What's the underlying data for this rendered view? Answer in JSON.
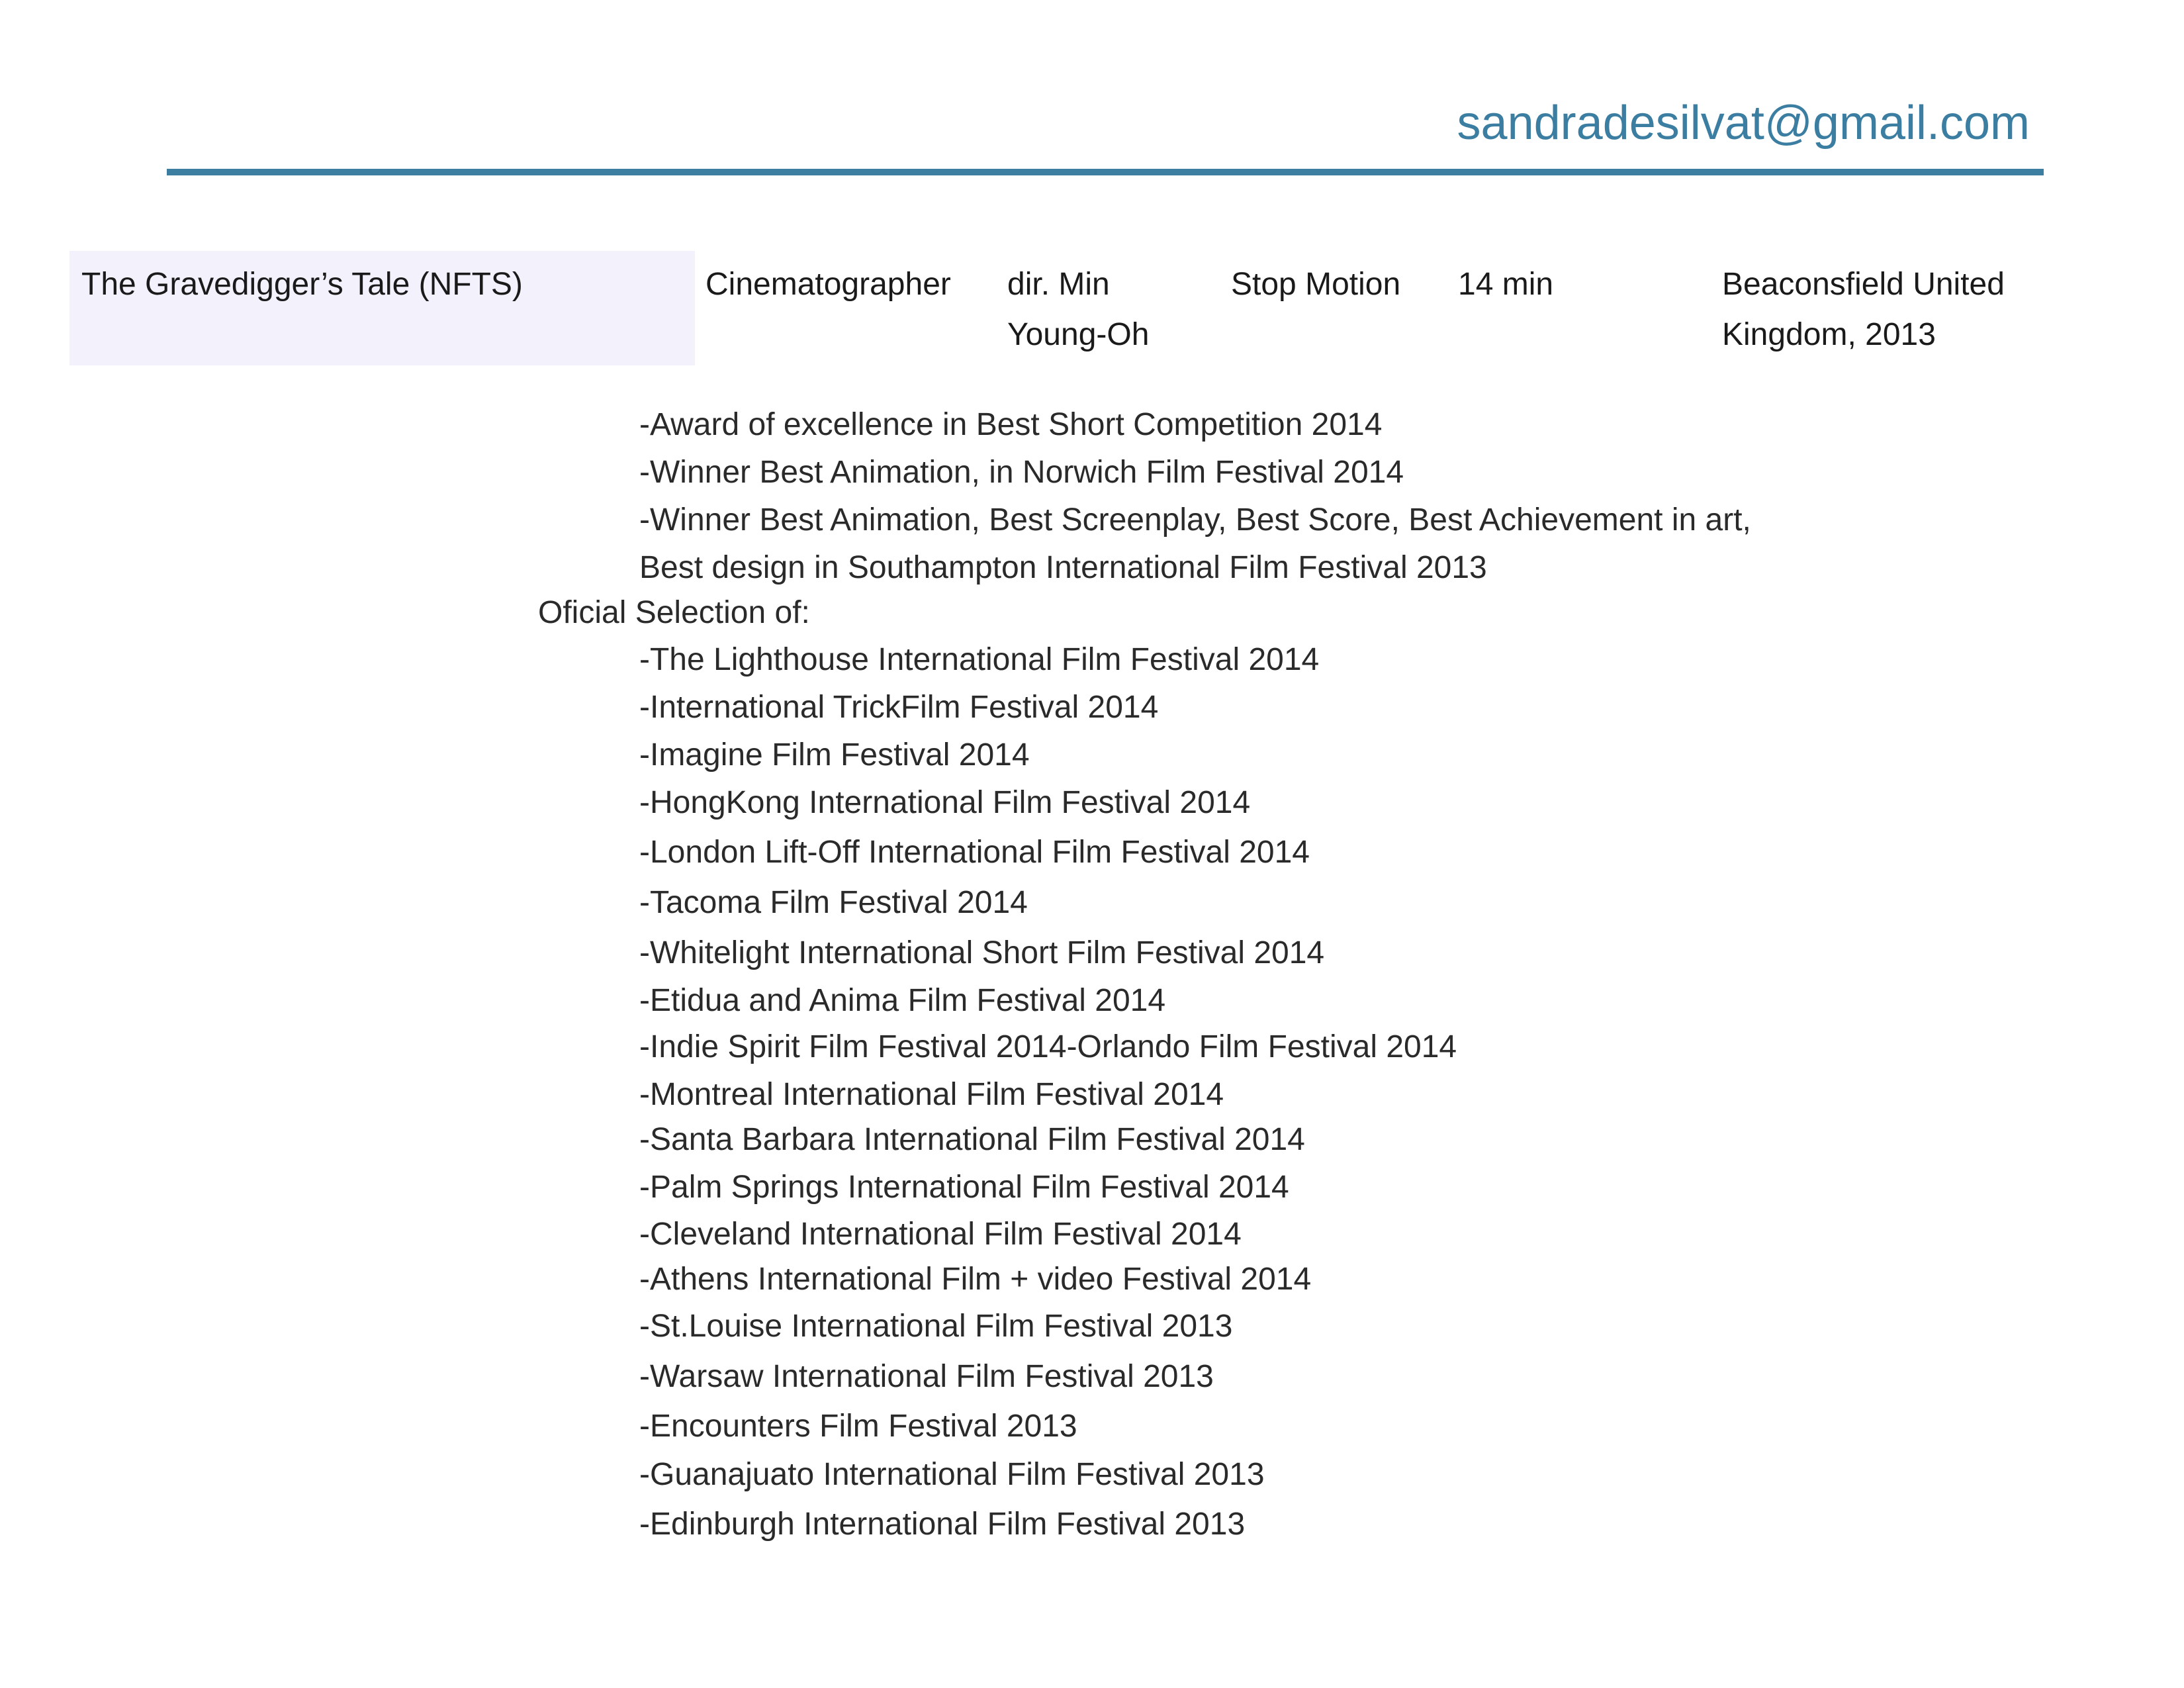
{
  "header": {
    "email": "sandradesilvat@gmail.com"
  },
  "credit": {
    "title": "The Gravedigger’s Tale (NFTS)",
    "role": "Cinematographer",
    "director_line1": "dir. Min",
    "director_line2": "Young-Oh",
    "technique": "Stop Motion",
    "duration": "14 min",
    "location_line1": "Beaconsfield United",
    "location_line2": "Kingdom, 2013"
  },
  "awards": [
    "-Award of excellence in Best Short Competition 2014",
    "-Winner Best Animation, in Norwich Film Festival 2014",
    "-Winner Best Animation, Best Screenplay, Best Score, Best Achievement in art,",
    "Best design in Southampton International Film Festival 2013"
  ],
  "selection_heading": "Oficial Selection of:",
  "selections": [
    "-The Lighthouse International Film Festival 2014",
    "-International TrickFilm Festival 2014",
    "-Imagine Film Festival 2014",
    "-HongKong International Film Festival 2014",
    "-London Lift-Off International Film Festival 2014",
    "-Tacoma Film Festival 2014",
    "-Whitelight International Short Film Festival 2014",
    "-Etidua and Anima Film Festival 2014",
    "-Indie Spirit Film Festival 2014-Orlando Film Festival 2014",
    "-Montreal International Film Festival 2014",
    "-Santa Barbara International Film Festival 2014",
    "-Palm Springs International Film Festival 2014",
    "-Cleveland International Film Festival 2014",
    "-Athens International Film + video Festival 2014",
    "-St.Louise International Film Festival 2013",
    "-Warsaw International Film Festival 2013",
    "-Encounters Film Festival 2013",
    "-Guanajuato International Film Festival 2013",
    "-Edinburgh International Film Festival 2013"
  ]
}
